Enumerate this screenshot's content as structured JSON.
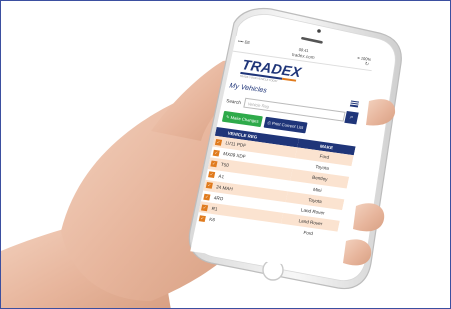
{
  "status_bar": {
    "carrier": "•••• EE",
    "time": "09:41",
    "battery": "≡ 100%"
  },
  "browser": {
    "url": "tradex.com"
  },
  "brand": {
    "logo": "TRADEX",
    "tagline": "TRADE YOUR VEHICLE TODAY"
  },
  "page": {
    "title": "My Vehicles"
  },
  "search": {
    "label": "Search",
    "placeholder": "Vehicle Reg"
  },
  "actions": {
    "make_changes": "Make Changes",
    "print_list": "Print Current List"
  },
  "table": {
    "headers": {
      "reg": "VEHICLE REG",
      "make": "MAKE"
    },
    "rows": [
      {
        "reg": "LV11 PDF",
        "make": "Ford"
      },
      {
        "reg": "MX09 XDF",
        "make": "Toyota"
      },
      {
        "reg": "T50",
        "make": "Bentley"
      },
      {
        "reg": "A1",
        "make": "Mini"
      },
      {
        "reg": "24 MAH",
        "make": "Toyota"
      },
      {
        "reg": "4RO",
        "make": "Land Rover"
      },
      {
        "reg": "R1",
        "make": "Land Rover"
      },
      {
        "reg": "K6",
        "make": "Ford"
      }
    ]
  },
  "colors": {
    "navy": "#1f3579",
    "orange": "#e07b1e",
    "green": "#2eaa4a",
    "row_tint": "#fbe3d0"
  },
  "icons": [
    "search-icon",
    "hamburger-menu-icon",
    "wrench-icon",
    "print-icon",
    "checkbox-icon",
    "reload-icon"
  ]
}
